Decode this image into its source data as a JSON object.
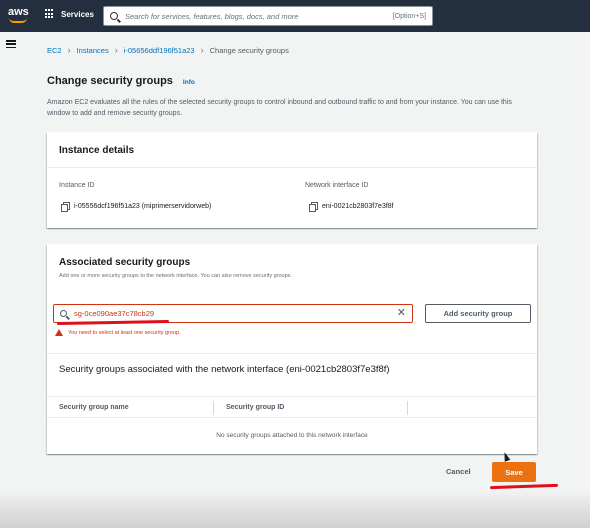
{
  "nav": {
    "logo": "aws",
    "services_label": "Services",
    "search_placeholder": "Search for services, features, blogs, docs, and more",
    "search_shortcut": "[Option+S]"
  },
  "breadcrumb": {
    "items": [
      "EC2",
      "Instances",
      "i-05656ddf196f51a23"
    ],
    "current": "Change security groups"
  },
  "page": {
    "title": "Change security groups",
    "info_label": "Info",
    "description": "Amazon EC2 evaluates all the rules of the selected security groups to control inbound and outbound traffic to and from your instance. You can use this window to add and remove security groups."
  },
  "instance_details": {
    "header": "Instance details",
    "instance_id_label": "Instance ID",
    "instance_id_value": "i-05556dcf196f51a23 (miprimerservidorweb)",
    "interface_id_label": "Network interface ID",
    "interface_id_value": "eni-0021cb2803f7e3f8f"
  },
  "security_groups": {
    "title": "Associated security groups",
    "subtitle": "Add one or more security groups to the network interface. You can also remove security groups.",
    "input_value": "sg-0ce090ae37c78cb29",
    "add_button": "Add security group",
    "error_text": "You need to select at least one security group.",
    "associated_title": "Security groups associated with the network interface (eni-0021cb2803f7e3f8f)",
    "columns": [
      "Security group name",
      "Security group ID"
    ],
    "empty_text": "No security groups attached to this network interface"
  },
  "footer": {
    "cancel_label": "Cancel",
    "save_label": "Save"
  },
  "colors": {
    "nav_bg": "#232f3e",
    "link": "#0073bb",
    "error": "#d13212",
    "primary": "#ec7211",
    "annotation": "#e0101b"
  }
}
